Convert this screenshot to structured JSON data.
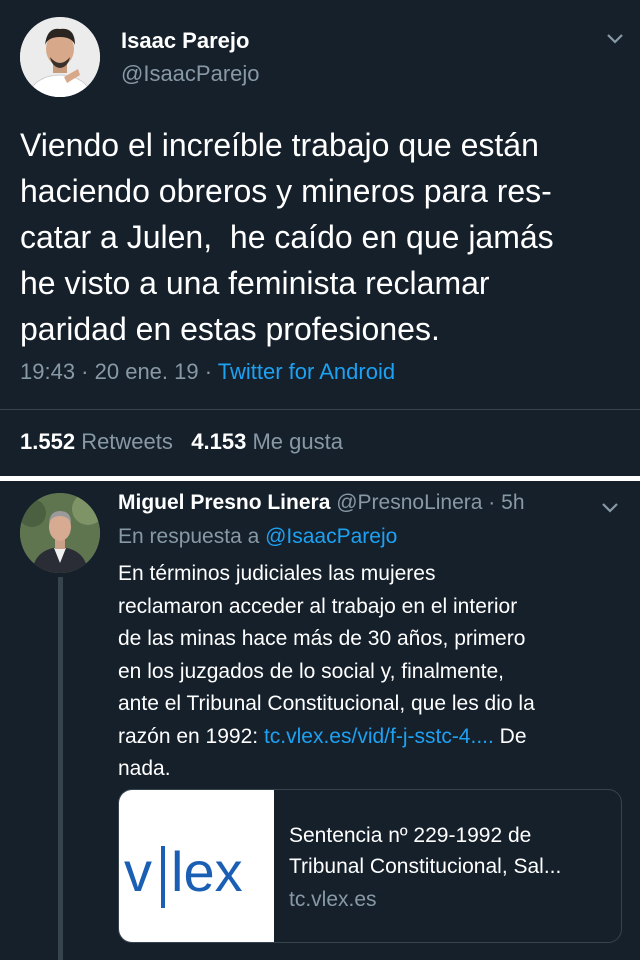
{
  "tweet": {
    "author_name": "Isaac Parejo",
    "author_handle": "@IsaacParejo",
    "text_lines": [
      "Viendo el increíble trabajo que están",
      "haciendo obreros y mineros para res-",
      "catar a Julen,  he caído en que jamás",
      "he visto a una feminista reclamar",
      "paridad en estas profesiones."
    ],
    "time": "19:43",
    "date": "20 ene. 19",
    "source": "Twitter for Android",
    "retweets_count": "1.552",
    "retweets_label": "Retweets",
    "likes_count": "4.153",
    "likes_label": "Me gusta"
  },
  "reply": {
    "author_name": "Miguel Presno Linera",
    "author_handle": "@PresnoLinera",
    "time_ago": "5h",
    "in_reply_prefix": "En respuesta a ",
    "in_reply_handle": "@IsaacParejo",
    "text_lines": [
      "En términos judiciales las mujeres",
      "reclamaron acceder al trabajo en el interior",
      "de las minas hace más de 30 años, primero",
      "en los juzgados de lo social y, finalmente,",
      "ante el Tribunal Constitucional, que les dio la"
    ],
    "text_last_prefix": "razón en 1992: ",
    "text_link": "tc.vlex.es/vid/f-j-sstc-4....",
    "text_last_suffix": " De",
    "text_end": "nada.",
    "card": {
      "logo_left": "v",
      "logo_right": "lex",
      "title_line1": "Sentencia nº 229-1992 de",
      "title_line2": "Tribunal Constitucional, Sal...",
      "domain": "tc.vlex.es",
      "logo_color": "#1a5fb4"
    }
  },
  "colors": {
    "background": "#15202b",
    "text_secondary": "#8899a6",
    "link": "#1da1f2"
  }
}
